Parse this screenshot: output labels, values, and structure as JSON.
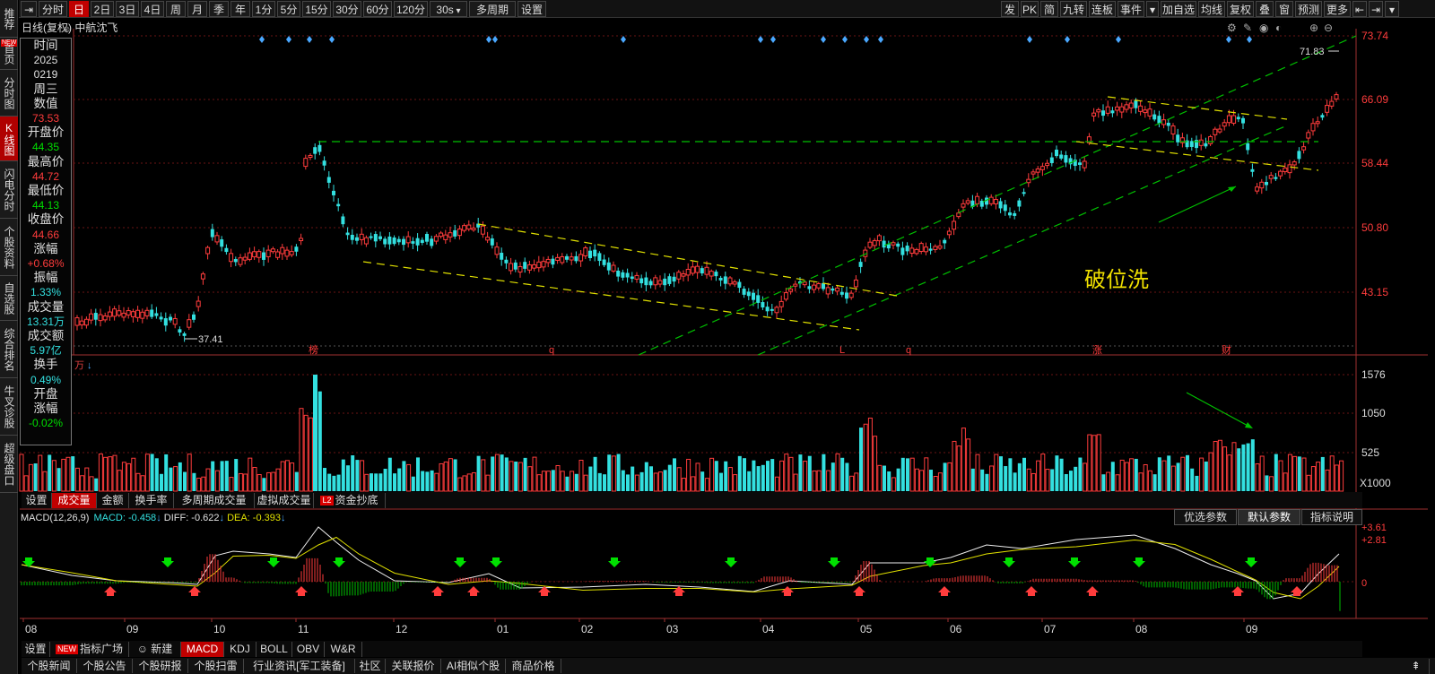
{
  "left_nav": [
    {
      "label": "推荐",
      "badge": "NEW"
    },
    {
      "label": "首页"
    },
    {
      "label": "分时图"
    },
    {
      "label": "K线图",
      "active": true
    },
    {
      "label": "闪电分时"
    },
    {
      "label": "个股资料"
    },
    {
      "label": "自选股"
    },
    {
      "label": "综合排名"
    },
    {
      "label": "牛叉诊股"
    },
    {
      "label": "超级盘口"
    }
  ],
  "toolbar_left": [
    "分时",
    "日",
    "2日",
    "3日",
    "4日",
    "周",
    "月",
    "季",
    "年",
    "1分",
    "5分",
    "15分",
    "30分",
    "60分",
    "120分",
    "30s",
    "多周期",
    "设置"
  ],
  "toolbar_active": "日",
  "toolbar_right": [
    "发",
    "PK",
    "简",
    "九转",
    "连板",
    "事件",
    "加自选",
    "均线",
    "复权",
    "叠",
    "窗",
    "预测",
    "更多"
  ],
  "subtitle": "日线(复权)  中航沈飞",
  "info_panel": [
    {
      "text": "时间",
      "cls": "ip-label"
    },
    {
      "text": "2025",
      "cls": "c-white"
    },
    {
      "text": "0219",
      "cls": "c-white"
    },
    {
      "text": "周三",
      "cls": "ip-label"
    },
    {
      "text": "数值",
      "cls": "ip-label"
    },
    {
      "text": "73.53",
      "cls": "c-red"
    },
    {
      "text": "开盘价",
      "cls": "ip-label"
    },
    {
      "text": "44.35",
      "cls": "c-green"
    },
    {
      "text": "最高价",
      "cls": "ip-label"
    },
    {
      "text": "44.72",
      "cls": "c-red"
    },
    {
      "text": "最低价",
      "cls": "ip-label"
    },
    {
      "text": "44.13",
      "cls": "c-green"
    },
    {
      "text": "收盘价",
      "cls": "ip-label"
    },
    {
      "text": "44.66",
      "cls": "c-red"
    },
    {
      "text": "涨幅",
      "cls": "ip-label"
    },
    {
      "text": "+0.68%",
      "cls": "c-red"
    },
    {
      "text": "振幅",
      "cls": "ip-label"
    },
    {
      "text": "1.33%",
      "cls": "c-cyan"
    },
    {
      "text": "成交量",
      "cls": "ip-label"
    },
    {
      "text": "13.31万",
      "cls": "c-cyan"
    },
    {
      "text": "成交额",
      "cls": "ip-label"
    },
    {
      "text": "5.97亿",
      "cls": "c-cyan"
    },
    {
      "text": "换手",
      "cls": "ip-label"
    },
    {
      "text": "0.49%",
      "cls": "c-cyan"
    },
    {
      "text": "开盘",
      "cls": "ip-label"
    },
    {
      "text": "涨幅",
      "cls": "ip-label"
    },
    {
      "text": "-0.02%",
      "cls": "c-green"
    }
  ],
  "price_axis": [
    "73.74",
    "66.09",
    "58.44",
    "50.80",
    "43.15"
  ],
  "price_annotations": {
    "low": "37.41",
    "high": "71.83"
  },
  "event_marks": [
    "榜",
    "q",
    "L",
    "q",
    "涨",
    "财"
  ],
  "chart_annotation": "破位洗",
  "volume_unit": "万",
  "volume_axis": [
    "1576",
    "1050",
    "525",
    "X1000"
  ],
  "indicator_tabs": [
    "设置",
    "成交量",
    "金额",
    "换手率",
    "多周期成交量",
    "虚拟成交量",
    "资金抄底"
  ],
  "indicator_tabs_active": "成交量",
  "l2_badge": "L2",
  "macd": {
    "title": "MACD(12,26,9)",
    "macd_label": "MACD: -0.458",
    "diff_label": "DIFF: -0.622",
    "dea_label": "DEA: -0.393",
    "axis": [
      "3.61",
      "2.81",
      "0"
    ]
  },
  "param_buttons": [
    "优选参数",
    "默认参数",
    "指标说明"
  ],
  "param_active": "默认参数",
  "x_axis": [
    "08",
    "09",
    "10",
    "11",
    "12",
    "01",
    "02",
    "03",
    "04",
    "05",
    "06",
    "07",
    "08",
    "09"
  ],
  "bottom_tabs": [
    "设置",
    "指标广场",
    "新建",
    "MACD",
    "KDJ",
    "BOLL",
    "OBV",
    "W&R"
  ],
  "bottom_tabs_active": "MACD",
  "new_badge": "NEW",
  "footer_tabs": [
    "个股新闻",
    "个股公告",
    "个股研报",
    "个股扫雷",
    "行业资讯[军工装备]",
    "社区",
    "关联报价",
    "AI相似个股",
    "商品价格"
  ],
  "colors": {
    "up": "#ff3c3c",
    "down": "#33e0e0",
    "trend_green": "#00c000",
    "trend_yellow": "#e0e000",
    "diamond": "#4aa8ff"
  }
}
